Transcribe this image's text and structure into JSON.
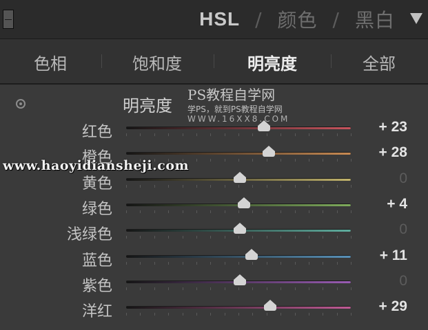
{
  "header": {
    "hsl": "HSL",
    "separator": "/",
    "color": "颜色",
    "bw": "黑白",
    "dropdown_icon": "triangle-down-icon",
    "toggle_icon": "panel-toggle-icon"
  },
  "tabs": [
    {
      "label": "色相",
      "active": false
    },
    {
      "label": "饱和度",
      "active": false
    },
    {
      "label": "明亮度",
      "active": true
    },
    {
      "label": "全部",
      "active": false
    }
  ],
  "section": {
    "title": "明亮度",
    "target_icon": "targeted-adjustment-icon"
  },
  "watermarks": {
    "title": "PS教程自学网",
    "subtitle": "学PS，就到PS教程自学网",
    "url": "WWW.16XX8.COM",
    "site": "www.haoyidiansheji.com"
  },
  "sliders": [
    {
      "label": "红色",
      "value": 23,
      "display": "+ 23",
      "track_color": "#c7545d"
    },
    {
      "label": "橙色",
      "value": 28,
      "display": "+ 28",
      "track_color": "#c88a52"
    },
    {
      "label": "黄色",
      "value": 0,
      "display": "0",
      "track_color": "#c2b46c"
    },
    {
      "label": "绿色",
      "value": 4,
      "display": "+ 4",
      "track_color": "#7fac5c"
    },
    {
      "label": "浅绿色",
      "value": 0,
      "display": "0",
      "track_color": "#5fae9f"
    },
    {
      "label": "蓝色",
      "value": 11,
      "display": "+ 11",
      "track_color": "#5891b8"
    },
    {
      "label": "紫色",
      "value": 0,
      "display": "0",
      "track_color": "#9a5cb4"
    },
    {
      "label": "洋红",
      "value": 29,
      "display": "+ 29",
      "track_color": "#c05a95"
    }
  ],
  "slider_range": [
    -100,
    100
  ],
  "colors": {
    "background": "#3a3a3a",
    "header": "#2b2b2b",
    "text": "#c4c4c4",
    "handle": "#d4d4d4"
  }
}
